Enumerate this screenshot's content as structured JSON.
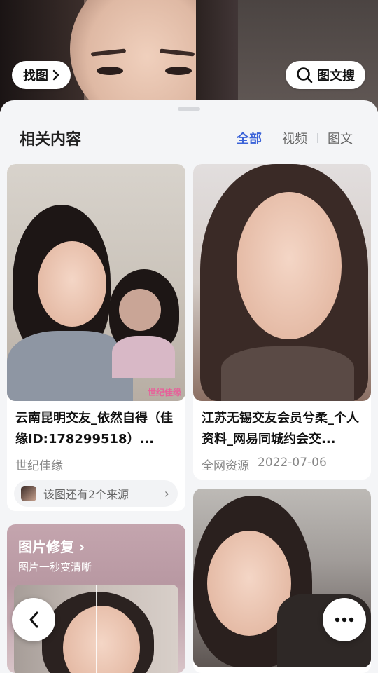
{
  "hero": {
    "find_label": "找图",
    "search_label": "图文搜"
  },
  "sheet": {
    "title": "相关内容",
    "tabs": [
      {
        "label": "全部",
        "active": true
      },
      {
        "label": "视频",
        "active": false
      },
      {
        "label": "图文",
        "active": false
      }
    ]
  },
  "results": [
    {
      "title": "云南昆明交友_依然自得（佳缘ID:178299518）...",
      "source": "世纪佳缘",
      "date": "",
      "more_sources": "该图还有2个来源",
      "watermark": "世纪佳缘"
    },
    {
      "title": "江苏无锡交友会员兮柔_个人资料_网易同城约会交...",
      "source": "全网资源",
      "date": "2022-07-06"
    }
  ],
  "promo": {
    "title": "图片修复",
    "subtitle": "图片一秒变清晰"
  },
  "colors": {
    "accent": "#3b63d8",
    "sheet_bg": "#f4f5f7"
  },
  "icons": {
    "find": "chevron-right-icon",
    "search": "search-icon",
    "back": "chevron-left-icon",
    "more": "more-horizontal-icon"
  }
}
